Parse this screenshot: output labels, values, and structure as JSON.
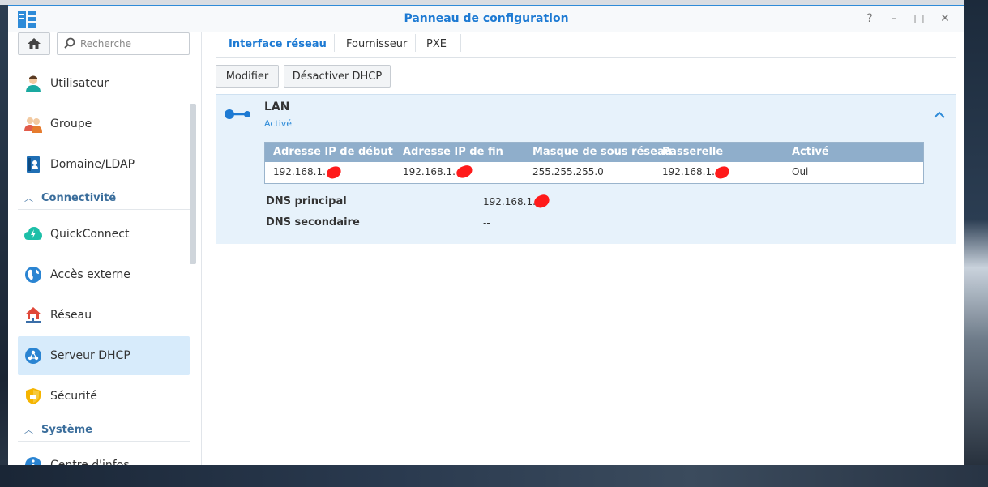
{
  "window": {
    "title": "Panneau de configuration",
    "controls": [
      "?",
      "–",
      "□",
      "✕"
    ]
  },
  "sidebar": {
    "search_placeholder": "Recherche",
    "items": [
      {
        "label": "Utilisateur"
      },
      {
        "label": "Groupe"
      },
      {
        "label": "Domaine/LDAP"
      },
      {
        "label": "QuickConnect"
      },
      {
        "label": "Accès externe"
      },
      {
        "label": "Réseau"
      },
      {
        "label": "Serveur DHCP"
      },
      {
        "label": "Sécurité"
      },
      {
        "label": "Centre d'infos"
      }
    ],
    "sections": [
      {
        "label": "Connectivité"
      },
      {
        "label": "Système"
      }
    ],
    "active_item": "Serveur DHCP"
  },
  "tabs": [
    {
      "label": "Interface réseau"
    },
    {
      "label": "Fournisseur"
    },
    {
      "label": "PXE"
    }
  ],
  "toolbar": {
    "edit_label": "Modifier",
    "disable_label": "Désactiver DHCP"
  },
  "lan": {
    "title": "LAN",
    "status": "Activé",
    "columns": [
      "Adresse IP de début",
      "Adresse IP de fin",
      "Masque de sous réseau",
      "Passerelle",
      "Activé"
    ],
    "row": [
      "192.168.1.",
      "192.168.1.",
      "255.255.255.0",
      "192.168.1.",
      "Oui"
    ],
    "dns_primary_label": "DNS principal",
    "dns_primary_value": "192.168.1.",
    "dns_secondary_label": "DNS secondaire",
    "dns_secondary_value": "--"
  },
  "colors": {
    "accent": "#1d7ad3",
    "active_bg": "#d7ebfb",
    "panel_bg": "#e7f2fb",
    "table_header": "#8faecb",
    "redaction": "#ff1a1a"
  }
}
